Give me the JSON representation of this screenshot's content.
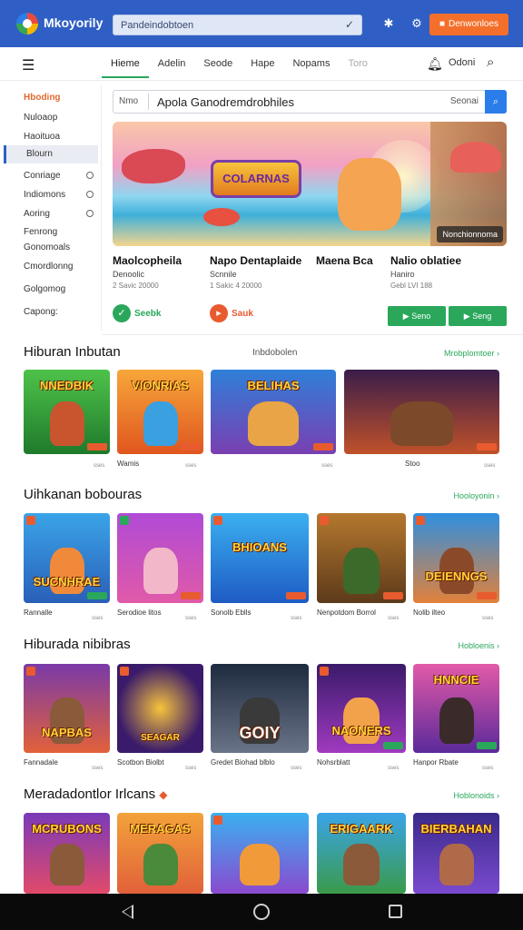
{
  "topbar": {
    "brand": "Mkoyorily",
    "search_value": "Pandeindobtoen",
    "cta_label": "Denwonloes",
    "colors": {
      "bar": "#2f5fc4",
      "cta": "#f46f2b"
    }
  },
  "nav": {
    "tabs": [
      {
        "label": "Hieme",
        "active": true
      },
      {
        "label": "Adelin"
      },
      {
        "label": "Seode"
      },
      {
        "label": "Hape"
      },
      {
        "label": "Nopams"
      },
      {
        "label": "Toro"
      }
    ],
    "user_label": "Odoni"
  },
  "sidebar": {
    "items": [
      {
        "label": "Hboding",
        "style": "accent"
      },
      {
        "label": "Nuloaop"
      },
      {
        "label": "Haoituoa"
      },
      {
        "label": "Blourn",
        "style": "selected"
      },
      {
        "label": "Conriage"
      },
      {
        "label": "Indiomons"
      },
      {
        "label": "Aoring"
      },
      {
        "label": "Fenrong"
      },
      {
        "label": "Gonomoals"
      },
      {
        "label": "Cmordlonng"
      },
      {
        "label": "Golgomog"
      },
      {
        "label": "Capong:"
      }
    ]
  },
  "featured": {
    "search_prefix": "Nmo",
    "search_value": "Apola Ganodremdrobhiles",
    "search_suffix": "Seonai",
    "banner_logo": "COLARNAS",
    "banner_badge": "Nonchionnoma",
    "items": [
      {
        "title": "Maolcopheila",
        "sub": "Denoolic",
        "meta": "2 Savic 20000"
      },
      {
        "title": "Napo Dentaplaide",
        "sub": "Scnnile",
        "meta": "1 Sakic 4 20000"
      },
      {
        "title": "Maena Bca",
        "sub": "",
        "meta": ""
      },
      {
        "title": "Nalio oblatiee",
        "sub": "Haniro",
        "meta": "Gebl LVI 188"
      }
    ],
    "chip_left": "Seebk",
    "chip_right": "Sauk",
    "btn_left": "Seno",
    "btn_right": "Seng",
    "accent": "#2aa75b"
  },
  "sections": [
    {
      "title": "Hiburan Inbutan",
      "mid": "Inbdobolen",
      "link": "Mrobplomtoer",
      "cards": [
        {
          "title": "NNEDBIK",
          "caption": "",
          "count": "sses"
        },
        {
          "title": "VIONRIAS",
          "caption": "Wamis",
          "count": "sses"
        },
        {
          "title": "BELIHAS",
          "caption": "",
          "count": "sses"
        },
        {
          "title": "",
          "caption": "Stoo",
          "count": "sses"
        },
        {
          "title": "",
          "caption": "",
          "count": ""
        }
      ]
    },
    {
      "title": "Uihkanan bobouras",
      "mid": "",
      "link": "Hooloyonin",
      "cards": [
        {
          "title": "SUCNHRAE",
          "caption": "Rannalle",
          "count": "sses"
        },
        {
          "title": "",
          "caption": "Serodioe litos",
          "count": "sses"
        },
        {
          "title": "BHIOANS",
          "caption": "Sonolb Eblls",
          "count": "sses"
        },
        {
          "title": "",
          "caption": "Nenpotdom Borrol",
          "count": "sses"
        },
        {
          "title": "DEIENNGS",
          "caption": "Nolib ilteo",
          "count": "sses"
        }
      ]
    },
    {
      "title": "Hiburada nibibras",
      "mid": "",
      "link": "Hobloenis",
      "cards": [
        {
          "title": "NAPBAS",
          "caption": "Fannadale",
          "count": "sses"
        },
        {
          "title": "SEAGAR",
          "caption": "Scotbon Biolbt",
          "count": "sses"
        },
        {
          "title": "GOIY",
          "caption": "Gredet Biohad blblo",
          "count": "sses"
        },
        {
          "title": "NAONERS",
          "caption": "Nohsrblatt",
          "count": "sses"
        },
        {
          "title": "HNNCIE",
          "caption": "Hanpor Rbate",
          "count": "sses"
        }
      ]
    },
    {
      "title": "Meradadontlor Irlcans",
      "mid": "",
      "link": "Hoblonoids",
      "cards": [
        {
          "title": "MCRUBONS",
          "caption": "",
          "count": ""
        },
        {
          "title": "MERAGAS",
          "caption": "",
          "count": ""
        },
        {
          "title": "",
          "caption": "",
          "count": ""
        },
        {
          "title": "ERIGAARK",
          "caption": "",
          "count": ""
        },
        {
          "title": "BIERBAHAN",
          "caption": "",
          "count": ""
        }
      ]
    }
  ]
}
